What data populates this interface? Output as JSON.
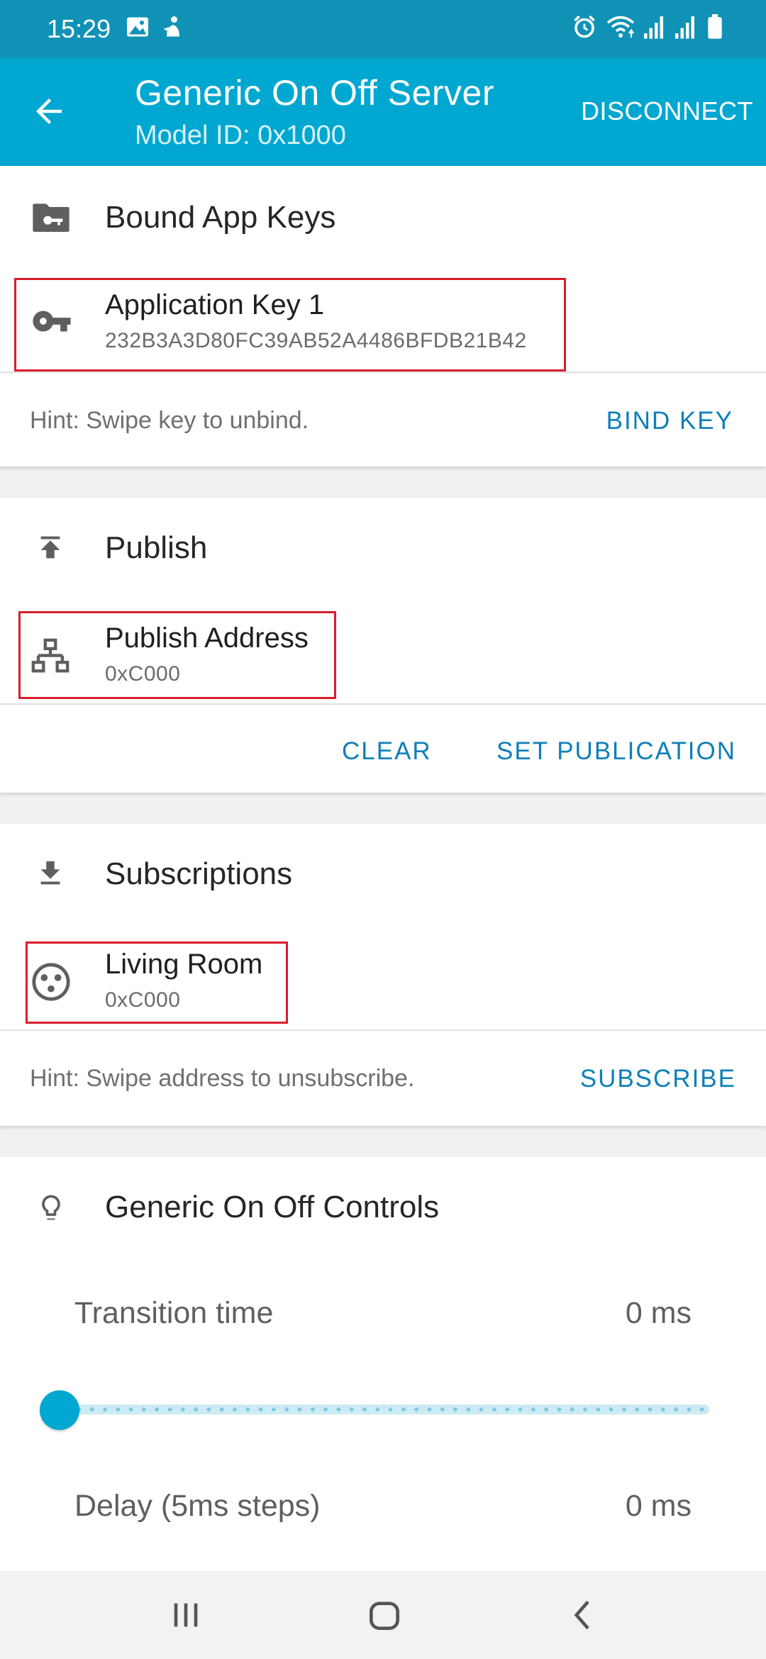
{
  "status_bar": {
    "time": "15:29",
    "left_icons": [
      "image-icon",
      "assistant-icon"
    ],
    "right_icons": [
      "alarm-icon",
      "wifi-icon",
      "signal-icon",
      "signal-icon",
      "battery-icon"
    ]
  },
  "app_bar": {
    "title": "Generic On Off Server",
    "subtitle": "Model ID: 0x1000",
    "disconnect_label": "DISCONNECT",
    "back_icon": "arrow-back-icon",
    "background": "#00a7d0"
  },
  "bound_app_keys": {
    "header": "Bound App Keys",
    "icon": "folder-key-icon",
    "items": [
      {
        "title": "Application Key 1",
        "subtitle": "232B3A3D80FC39AB52A4486BFDB21B42",
        "icon": "key-icon"
      }
    ],
    "hint": "Hint: Swipe key to unbind.",
    "action": "BIND KEY"
  },
  "publish": {
    "header": "Publish",
    "icon": "publish-icon",
    "item": {
      "title": "Publish Address",
      "subtitle": "0xC000",
      "icon": "network-icon"
    },
    "clear_label": "CLEAR",
    "set_label": "SET PUBLICATION"
  },
  "subscriptions": {
    "header": "Subscriptions",
    "icon": "download-icon",
    "items": [
      {
        "title": "Living Room",
        "subtitle": "0xC000",
        "icon": "group-icon"
      }
    ],
    "hint": "Hint: Swipe address to unsubscribe.",
    "action": "SUBSCRIBE"
  },
  "controls": {
    "header": "Generic On Off Controls",
    "icon": "lightbulb-icon",
    "transition_label": "Transition time",
    "transition_value": "0 ms",
    "transition_slider_fraction": 0,
    "delay_label": "Delay (5ms steps)",
    "delay_value": "0 ms"
  },
  "accent_colors": {
    "primary": "#00a7d0",
    "action_text": "#0e7fb8",
    "highlight_box": "#d81e2b"
  }
}
